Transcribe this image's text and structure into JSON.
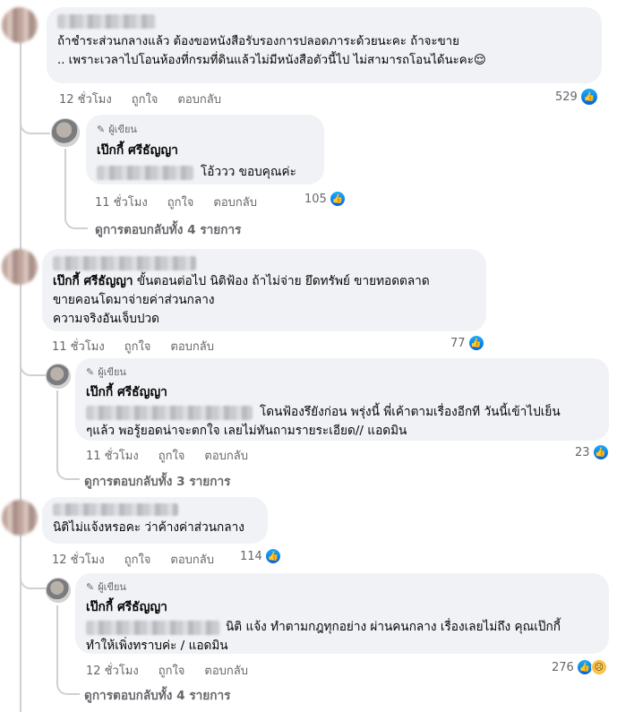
{
  "c1": {
    "text": "ถ้าชำระส่วนกลางแล้ว ต้องขอหนังสือรับรองการปลอดภาระด้วยนะคะ ถ้าจะขาย\n.. เพราะเวลาไปโอนห้องที่กรมที่ดินแล้วไม่มีหนังสือตัวนี้ไป ไม่สามารถโอนได้นะคะ😌",
    "time": "12 ชั่วโมง",
    "like": "ถูกใจ",
    "reply": "ตอบกลับ",
    "count": "529",
    "r1": {
      "badge": "ผู้เขียน",
      "name": "เป๊กกี้ ศรีธัญญา",
      "text": "โอ้ววว ขอบคุณค่ะ",
      "time": "11 ชั่วโมง",
      "like": "ถูกใจ",
      "reply": "ตอบกลับ",
      "count": "105"
    },
    "viewmore": "ดูการตอบกลับทั้ง 4 รายการ"
  },
  "c2": {
    "mention": "เป๊กกี้ ศรีธัญญา",
    "text1": " ขั้นตอนต่อไป นิติฟ้อง ถ้าไม่จ่าย ยึดทรัพย์ ขายทอดตลาด",
    "text2": "ขายคอนโดมาจ่ายค่าส่วนกลาง\nความจริงอันเจ็บปวด",
    "time": "11 ชั่วโมง",
    "like": "ถูกใจ",
    "reply": "ตอบกลับ",
    "count": "77",
    "r1": {
      "badge": "ผู้เขียน",
      "name": "เป๊กกี้ ศรีธัญญา",
      "text1": "โดนฟ้องรึยังก่อน พรุ่งนี้ พี่เค้าตามเรื่องอีกที วันนี้เข้าไปเย็น",
      "text2": "ๆแล้ว พอรู้ยอดน่าจะตกใจ เลยไม่ทันถามรายระเอียด// แอดมิน",
      "time": "11 ชั่วโมง",
      "like": "ถูกใจ",
      "reply": "ตอบกลับ",
      "count": "23"
    },
    "viewmore": "ดูการตอบกลับทั้ง 3 รายการ"
  },
  "c3": {
    "text": "นิติไม่แจ้งหรอคะ ว่าค้างค่าส่วนกลาง",
    "time": "12 ชั่วโมง",
    "like": "ถูกใจ",
    "reply": "ตอบกลับ",
    "count": "114",
    "r1": {
      "badge": "ผู้เขียน",
      "name": "เป๊กกี้ ศรีธัญญา",
      "text1": "นิติ แจ้ง ทำตามกฎทุกอย่าง ผ่านคนกลาง เรื่องเลยไม่ถึง คุณเป๊กกี้",
      "text2": "ทำให้เพิ่งทราบค่ะ / แอดมิน",
      "time": "12 ชั่วโมง",
      "like": "ถูกใจ",
      "reply": "ตอบกลับ",
      "count": "276"
    },
    "viewmore": "ดูการตอบกลับทั้ง 4 รายการ"
  },
  "colors": {
    "like": "#0866ff",
    "bubble": "#f0f2f5",
    "meta": "#65676b"
  },
  "icons": {
    "like": "thumbs-up-icon",
    "sad": "sad-face-icon",
    "pen": "pen-icon"
  }
}
